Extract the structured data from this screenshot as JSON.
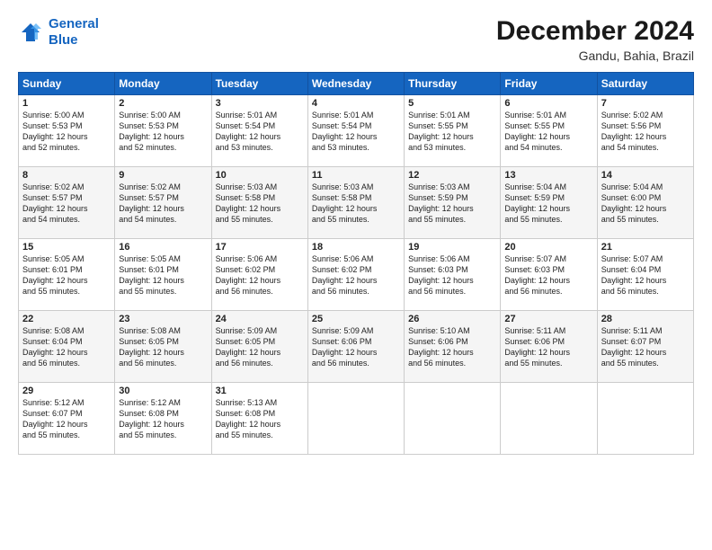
{
  "logo": {
    "line1": "General",
    "line2": "Blue"
  },
  "title": "December 2024",
  "subtitle": "Gandu, Bahia, Brazil",
  "days_header": [
    "Sunday",
    "Monday",
    "Tuesday",
    "Wednesday",
    "Thursday",
    "Friday",
    "Saturday"
  ],
  "weeks": [
    [
      {
        "day": "1",
        "text": "Sunrise: 5:00 AM\nSunset: 5:53 PM\nDaylight: 12 hours\nand 52 minutes."
      },
      {
        "day": "2",
        "text": "Sunrise: 5:00 AM\nSunset: 5:53 PM\nDaylight: 12 hours\nand 52 minutes."
      },
      {
        "day": "3",
        "text": "Sunrise: 5:01 AM\nSunset: 5:54 PM\nDaylight: 12 hours\nand 53 minutes."
      },
      {
        "day": "4",
        "text": "Sunrise: 5:01 AM\nSunset: 5:54 PM\nDaylight: 12 hours\nand 53 minutes."
      },
      {
        "day": "5",
        "text": "Sunrise: 5:01 AM\nSunset: 5:55 PM\nDaylight: 12 hours\nand 53 minutes."
      },
      {
        "day": "6",
        "text": "Sunrise: 5:01 AM\nSunset: 5:55 PM\nDaylight: 12 hours\nand 54 minutes."
      },
      {
        "day": "7",
        "text": "Sunrise: 5:02 AM\nSunset: 5:56 PM\nDaylight: 12 hours\nand 54 minutes."
      }
    ],
    [
      {
        "day": "8",
        "text": "Sunrise: 5:02 AM\nSunset: 5:57 PM\nDaylight: 12 hours\nand 54 minutes."
      },
      {
        "day": "9",
        "text": "Sunrise: 5:02 AM\nSunset: 5:57 PM\nDaylight: 12 hours\nand 54 minutes."
      },
      {
        "day": "10",
        "text": "Sunrise: 5:03 AM\nSunset: 5:58 PM\nDaylight: 12 hours\nand 55 minutes."
      },
      {
        "day": "11",
        "text": "Sunrise: 5:03 AM\nSunset: 5:58 PM\nDaylight: 12 hours\nand 55 minutes."
      },
      {
        "day": "12",
        "text": "Sunrise: 5:03 AM\nSunset: 5:59 PM\nDaylight: 12 hours\nand 55 minutes."
      },
      {
        "day": "13",
        "text": "Sunrise: 5:04 AM\nSunset: 5:59 PM\nDaylight: 12 hours\nand 55 minutes."
      },
      {
        "day": "14",
        "text": "Sunrise: 5:04 AM\nSunset: 6:00 PM\nDaylight: 12 hours\nand 55 minutes."
      }
    ],
    [
      {
        "day": "15",
        "text": "Sunrise: 5:05 AM\nSunset: 6:01 PM\nDaylight: 12 hours\nand 55 minutes."
      },
      {
        "day": "16",
        "text": "Sunrise: 5:05 AM\nSunset: 6:01 PM\nDaylight: 12 hours\nand 55 minutes."
      },
      {
        "day": "17",
        "text": "Sunrise: 5:06 AM\nSunset: 6:02 PM\nDaylight: 12 hours\nand 56 minutes."
      },
      {
        "day": "18",
        "text": "Sunrise: 5:06 AM\nSunset: 6:02 PM\nDaylight: 12 hours\nand 56 minutes."
      },
      {
        "day": "19",
        "text": "Sunrise: 5:06 AM\nSunset: 6:03 PM\nDaylight: 12 hours\nand 56 minutes."
      },
      {
        "day": "20",
        "text": "Sunrise: 5:07 AM\nSunset: 6:03 PM\nDaylight: 12 hours\nand 56 minutes."
      },
      {
        "day": "21",
        "text": "Sunrise: 5:07 AM\nSunset: 6:04 PM\nDaylight: 12 hours\nand 56 minutes."
      }
    ],
    [
      {
        "day": "22",
        "text": "Sunrise: 5:08 AM\nSunset: 6:04 PM\nDaylight: 12 hours\nand 56 minutes."
      },
      {
        "day": "23",
        "text": "Sunrise: 5:08 AM\nSunset: 6:05 PM\nDaylight: 12 hours\nand 56 minutes."
      },
      {
        "day": "24",
        "text": "Sunrise: 5:09 AM\nSunset: 6:05 PM\nDaylight: 12 hours\nand 56 minutes."
      },
      {
        "day": "25",
        "text": "Sunrise: 5:09 AM\nSunset: 6:06 PM\nDaylight: 12 hours\nand 56 minutes."
      },
      {
        "day": "26",
        "text": "Sunrise: 5:10 AM\nSunset: 6:06 PM\nDaylight: 12 hours\nand 56 minutes."
      },
      {
        "day": "27",
        "text": "Sunrise: 5:11 AM\nSunset: 6:06 PM\nDaylight: 12 hours\nand 55 minutes."
      },
      {
        "day": "28",
        "text": "Sunrise: 5:11 AM\nSunset: 6:07 PM\nDaylight: 12 hours\nand 55 minutes."
      }
    ],
    [
      {
        "day": "29",
        "text": "Sunrise: 5:12 AM\nSunset: 6:07 PM\nDaylight: 12 hours\nand 55 minutes."
      },
      {
        "day": "30",
        "text": "Sunrise: 5:12 AM\nSunset: 6:08 PM\nDaylight: 12 hours\nand 55 minutes."
      },
      {
        "day": "31",
        "text": "Sunrise: 5:13 AM\nSunset: 6:08 PM\nDaylight: 12 hours\nand 55 minutes."
      },
      {
        "day": "",
        "text": ""
      },
      {
        "day": "",
        "text": ""
      },
      {
        "day": "",
        "text": ""
      },
      {
        "day": "",
        "text": ""
      }
    ]
  ]
}
